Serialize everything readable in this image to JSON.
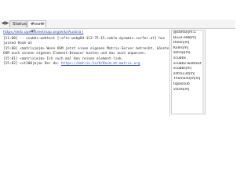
{
  "tabs": [
    {
      "label": "Status"
    },
    {
      "label": "#osm-at"
    }
  ],
  "close_glyph": "×",
  "topic": "https://wiki.openstreetmap.org/wiki/Austria |",
  "messages": [
    {
      "time": "[11:00]",
      "text": "-- scubbx-webtest [~sftc-web@84-113-75-15.cable.dynamic.surfer.at] has joined #osm-at"
    },
    {
      "time": "[15:00]",
      "text": "<matrixjm|m> Wenn OSM jetzt einen eigenen Matrix-Server betreibt, könnte OSM auch seinen eigenen Element-Browser hosten und das auch anpassen."
    },
    {
      "time": "[15:01]",
      "text": "<matrix|m|m> Ich such mal den reinen element-link."
    },
    {
      "time": "[15:02]",
      "text": "<vt100|m|m> Der da: ",
      "link": "https://matrix.to/#/#osm-at:matrix.org"
    }
  ],
  "users": [
    "@stefan|m:1",
    "Bu22-e88|m|",
    "theon|m|",
    "Kallis|m|",
    "zotrsp|m|",
    "scubbx",
    "scubbx-webtest",
    "scubbs|m|",
    "sotro234|m|",
    "ThomasU|m|m|",
    "tigox|sub",
    "vt100|m|"
  ]
}
